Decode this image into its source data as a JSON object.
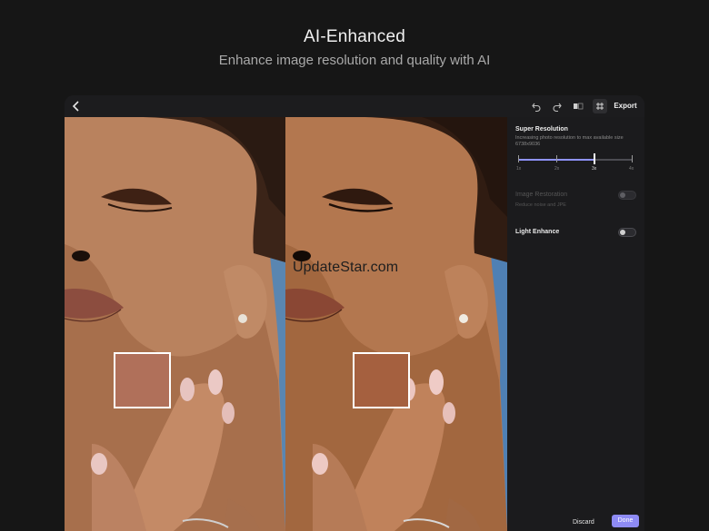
{
  "hero": {
    "title": "AI-Enhanced",
    "subtitle": "Enhance image resolution and quality with AI"
  },
  "toolbar": {
    "back_icon": "chevron-left-icon",
    "undo_icon": "undo-icon",
    "redo_icon": "redo-icon",
    "compare_icon": "compare-icon",
    "grid_icon": "grid-icon",
    "export_label": "Export"
  },
  "canvas": {
    "watermark": "UpdateStar.com"
  },
  "panel": {
    "super_resolution": {
      "title": "Super Resolution",
      "description": "Increasing photo resolution to max available size 6738x9036",
      "scale_options": [
        "1x",
        "2x",
        "3x",
        "4x"
      ],
      "selected": "3x",
      "selected_fraction": 0.667
    },
    "image_restoration": {
      "title": "Image Restoration",
      "description": "Reduce noise and JPE",
      "enabled": false,
      "disabled": true
    },
    "light_enhance": {
      "title": "Light Enhance",
      "enabled": false
    },
    "discard_label": "Discard",
    "done_label": "Done"
  },
  "colors": {
    "accent": "#8e8bf5",
    "background": "#161616",
    "panel": "#1b1b1d",
    "photo_backdrop": "#5a86b1"
  }
}
